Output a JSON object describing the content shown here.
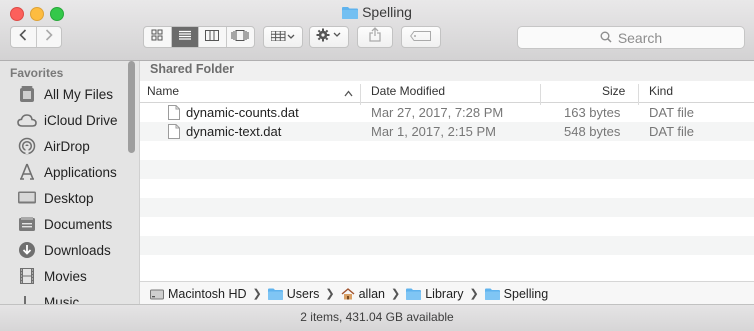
{
  "window": {
    "title": "Spelling"
  },
  "toolbar": {
    "search_placeholder": "Search"
  },
  "sidebar": {
    "heading": "Favorites",
    "items": [
      {
        "label": "All My Files",
        "icon": "all-files-icon"
      },
      {
        "label": "iCloud Drive",
        "icon": "cloud-icon"
      },
      {
        "label": "AirDrop",
        "icon": "airdrop-icon"
      },
      {
        "label": "Applications",
        "icon": "applications-icon"
      },
      {
        "label": "Desktop",
        "icon": "desktop-icon"
      },
      {
        "label": "Documents",
        "icon": "documents-icon"
      },
      {
        "label": "Downloads",
        "icon": "downloads-icon"
      },
      {
        "label": "Movies",
        "icon": "movies-icon"
      },
      {
        "label": "Music",
        "icon": "music-icon"
      }
    ]
  },
  "main": {
    "section_header": "Shared Folder",
    "columns": {
      "name": "Name",
      "date": "Date Modified",
      "size": "Size",
      "kind": "Kind"
    },
    "files": [
      {
        "name": "dynamic-counts.dat",
        "date": "Mar 27, 2017, 7:28 PM",
        "size": "163 bytes",
        "kind": "DAT file"
      },
      {
        "name": "dynamic-text.dat",
        "date": "Mar 1, 2017, 2:15 PM",
        "size": "548 bytes",
        "kind": "DAT file"
      }
    ]
  },
  "pathbar": {
    "crumbs": [
      "Macintosh HD",
      "Users",
      "allan",
      "Library",
      "Spelling"
    ]
  },
  "status": {
    "text": "2 items, 431.04 GB available"
  },
  "colors": {
    "folder_blue": "#5fb3ee",
    "accent": "#3a8ee6"
  }
}
